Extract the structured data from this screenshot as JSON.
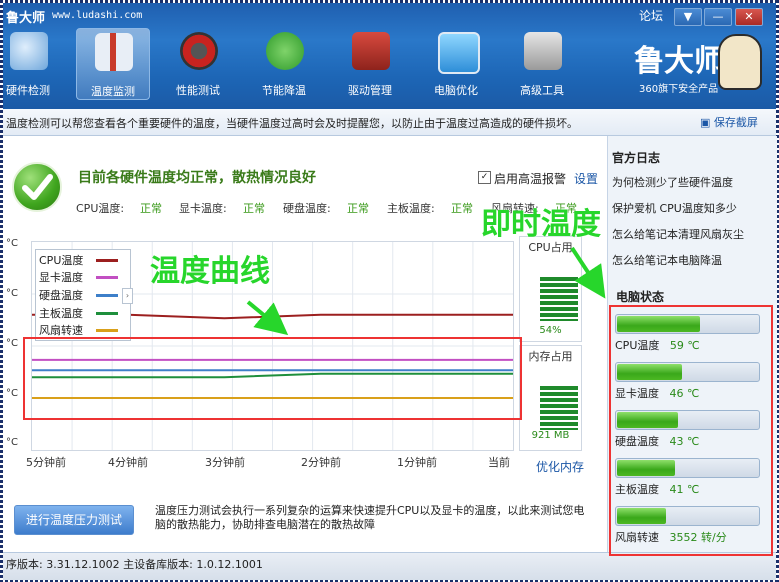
{
  "app": {
    "title": "鲁大师",
    "url": "www.ludashi.com",
    "forum": "论坛"
  },
  "window_buttons": [
    {
      "name": "menu-button",
      "glyph": "▼"
    },
    {
      "name": "minimize-button",
      "glyph": "—"
    },
    {
      "name": "close-button",
      "glyph": "✕"
    }
  ],
  "nav": {
    "tabs": [
      {
        "label": "硬件检测",
        "icon": "magnifier-icon"
      },
      {
        "label": "温度监测",
        "icon": "thermometer-icon",
        "active": true
      },
      {
        "label": "性能测试",
        "icon": "speedometer-icon"
      },
      {
        "label": "节能降温",
        "icon": "clover-icon"
      },
      {
        "label": "驱动管理",
        "icon": "toolbox-icon"
      },
      {
        "label": "电脑优化",
        "icon": "monitor-icon"
      },
      {
        "label": "高级工具",
        "icon": "printer-icon"
      }
    ]
  },
  "brand": {
    "logo": "鲁大师",
    "sub": "360旗下安全产品"
  },
  "info": {
    "text": "温度检测可以帮您查看各个重要硬件的温度，当硬件温度过高时会及时提醒您，以防止由于温度过高造成的硬件损坏。",
    "screenshot": "保存截屏"
  },
  "status": {
    "title": "目前各硬件温度均正常，散热情况良好",
    "alarm_label": "启用高温报警",
    "alarm_checked": true,
    "settings": "设置",
    "items": [
      {
        "label": "CPU温度:",
        "value": "正常"
      },
      {
        "label": "显卡温度:",
        "value": "正常"
      },
      {
        "label": "硬盘温度:",
        "value": "正常"
      },
      {
        "label": "主板温度:",
        "value": "正常"
      },
      {
        "label": "风扇转速:",
        "value": "正常"
      }
    ]
  },
  "chart_data": {
    "type": "line",
    "x": [
      "5分钟前",
      "4分钟前",
      "3分钟前",
      "2分钟前",
      "1分钟前",
      "当前"
    ],
    "y_tick_labels": [
      "°C",
      "°C",
      "°C",
      "°C",
      "°C"
    ],
    "series": [
      {
        "name": "CPU温度",
        "color": "#9c1f1f",
        "values": [
          59,
          59,
          58,
          59,
          59,
          59
        ]
      },
      {
        "name": "显卡温度",
        "color": "#c24fc2",
        "values": [
          46,
          46,
          46,
          46,
          46,
          46
        ]
      },
      {
        "name": "硬盘温度",
        "color": "#3d7fc9",
        "values": [
          43,
          43,
          43,
          43,
          43,
          43
        ]
      },
      {
        "name": "主板温度",
        "color": "#1e8f3c",
        "values": [
          41,
          41,
          41,
          42,
          42,
          42
        ]
      },
      {
        "name": "风扇转速",
        "color": "#d9a01a",
        "values": [
          35,
          35,
          35,
          35,
          35,
          35
        ]
      }
    ],
    "ylim": [
      20,
      80
    ]
  },
  "legend_collapse": "›",
  "usage": {
    "cpu": {
      "title": "CPU占用",
      "value": "54%",
      "fraction": 0.54
    },
    "mem": {
      "title": "内存占用",
      "value": "921 MB",
      "fraction": 0.5
    },
    "optimize": "优化内存"
  },
  "stress": {
    "button": "进行温度压力测试",
    "desc": "温度压力测试会执行一系列复杂的运算来快速提升CPU以及显卡的温度，以此来测试您电脑的散热能力，协助排查电脑潜在的散热故障"
  },
  "sidebar": {
    "log_title": "官方日志",
    "log_links": [
      "为何检测少了些硬件温度",
      "保护爱机 CPU温度知多少",
      "怎么给笔记本清理风扇灰尘",
      "怎么给笔记本电脑降温"
    ],
    "state_title": "电脑状态",
    "sensors": [
      {
        "label": "CPU温度",
        "value": "59 ℃",
        "fraction": 0.59
      },
      {
        "label": "显卡温度",
        "value": "46 ℃",
        "fraction": 0.46
      },
      {
        "label": "硬盘温度",
        "value": "43 ℃",
        "fraction": 0.43
      },
      {
        "label": "主板温度",
        "value": "41 ℃",
        "fraction": 0.41
      },
      {
        "label": "风扇转速",
        "value": "3552 转/分",
        "fraction": 0.35
      }
    ]
  },
  "statusbar": {
    "text": "序版本: 3.31.12.1002   主设备库版本: 1.0.12.1001"
  },
  "annotations": {
    "curve": "温度曲线",
    "realtime": "即时温度"
  },
  "colors": {
    "accent": "#2a78c9",
    "ok_green": "#3aa81a",
    "highlight": "#ee3333",
    "annot_green": "#27d62b"
  }
}
